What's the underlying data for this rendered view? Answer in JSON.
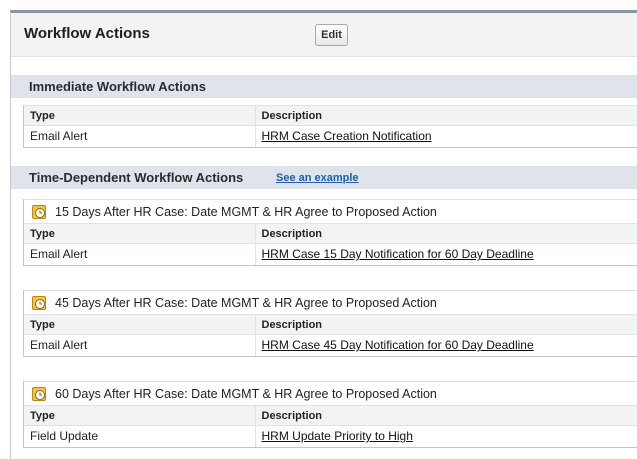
{
  "header": {
    "title": "Workflow Actions",
    "edit_label": "Edit"
  },
  "immediate": {
    "title": "Immediate Workflow Actions",
    "col_type": "Type",
    "col_desc": "Description",
    "rows": [
      {
        "type": "Email Alert",
        "desc": "HRM Case Creation Notification"
      }
    ]
  },
  "time_dependent": {
    "title": "Time-Dependent Workflow Actions",
    "example_link": "See an example",
    "groups": [
      {
        "title": "15 Days After HR Case: Date MGMT & HR Agree to Proposed Action",
        "col_type": "Type",
        "col_desc": "Description",
        "row": {
          "type": "Email Alert",
          "desc": "HRM Case 15 Day Notification for 60 Day Deadline"
        }
      },
      {
        "title": "45 Days After HR Case: Date MGMT & HR Agree to Proposed Action",
        "col_type": "Type",
        "col_desc": "Description",
        "row": {
          "type": "Email Alert",
          "desc": "HRM Case 45 Day Notification for 60 Day Deadline"
        }
      },
      {
        "title": "60 Days After HR Case: Date MGMT & HR Agree to Proposed Action",
        "col_type": "Type",
        "col_desc": "Description",
        "row": {
          "type": "Field Update",
          "desc": "HRM Update Priority to High"
        }
      }
    ]
  },
  "icons": {
    "time_trigger": "clock-icon"
  },
  "colors": {
    "section_bar": "#dfe3ec",
    "header_bg": "#f3f3f3",
    "link": "#1c5fa8"
  }
}
